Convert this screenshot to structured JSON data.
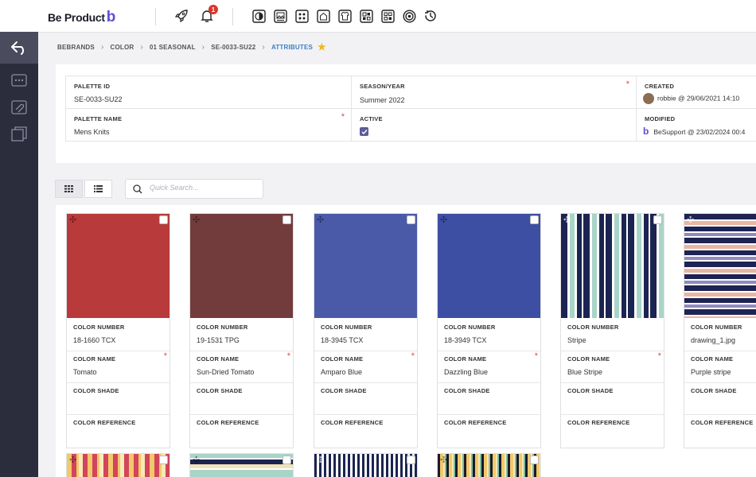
{
  "app": {
    "logo_text": "Be Product",
    "notification_count": "1"
  },
  "toolbar_icons": [
    "rocket-icon",
    "bell-icon",
    "contrast-icon",
    "image-board-icon",
    "grid-board-icon",
    "home-board-icon",
    "shirt-icon",
    "qr-board-icon",
    "apps-board-icon",
    "target-icon",
    "history-icon"
  ],
  "breadcrumb": {
    "items": [
      "BEBRANDS",
      "COLOR",
      "01 SEASONAL",
      "SE-0033-SU22"
    ],
    "current": "ATTRIBUTES"
  },
  "palette": {
    "id_label": "PALETTE ID",
    "id_value": "SE-0033-SU22",
    "season_label": "SEASON/YEAR",
    "season_value": "Summer 2022",
    "name_label": "PALETTE NAME",
    "name_value": "Mens Knits",
    "active_label": "ACTIVE",
    "created_label": "CREATED",
    "created_value": "robbie @ 29/06/2021 14:10",
    "modified_label": "MODIFIED",
    "modified_value": "BeSupport @ 23/02/2024 00:4"
  },
  "search": {
    "placeholder": "Quick Search..."
  },
  "card_labels": {
    "number": "COLOR NUMBER",
    "name": "COLOR NAME",
    "shade": "COLOR SHADE",
    "reference": "COLOR REFERENCE"
  },
  "cards": [
    {
      "number": "18-1660 TCX",
      "name": "Tomato",
      "color": "#b83a3a"
    },
    {
      "number": "19-1531 TPG",
      "name": "Sun-Dried Tomato",
      "color": "#733c3c"
    },
    {
      "number": "18-3945 TCX",
      "name": "Amparo Blue",
      "color": "#4a5aa8"
    },
    {
      "number": "18-3949 TCX",
      "name": "Dazzling Blue",
      "color": "#3d4fa3"
    },
    {
      "number": "Stripe",
      "name": "Blue Stripe",
      "color": "#1b2450"
    },
    {
      "number": "drawing_1.jpg",
      "name": "Purple stripe",
      "color": "#1e2352"
    }
  ]
}
